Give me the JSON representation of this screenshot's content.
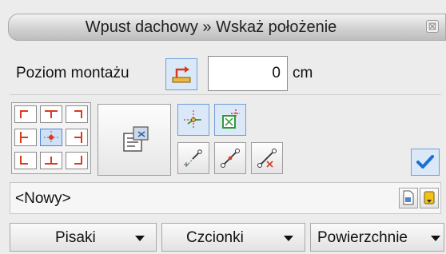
{
  "window": {
    "title": "Wpust dachowy » Wskaż położenie",
    "close_symbol": "⊠"
  },
  "mounting": {
    "label": "Poziom montażu",
    "value": "0",
    "unit": "cm"
  },
  "name_combo": {
    "value": "<Nowy>"
  },
  "dropdowns": [
    {
      "label": "Pisaki"
    },
    {
      "label": "Czcionki"
    },
    {
      "label": "Powierzchnie"
    }
  ],
  "colors": {
    "accent": "#2b78d6",
    "confirm": "#1a6fd8",
    "drawing_red": "#d83a20",
    "drawing_green": "#2f9a3a"
  }
}
